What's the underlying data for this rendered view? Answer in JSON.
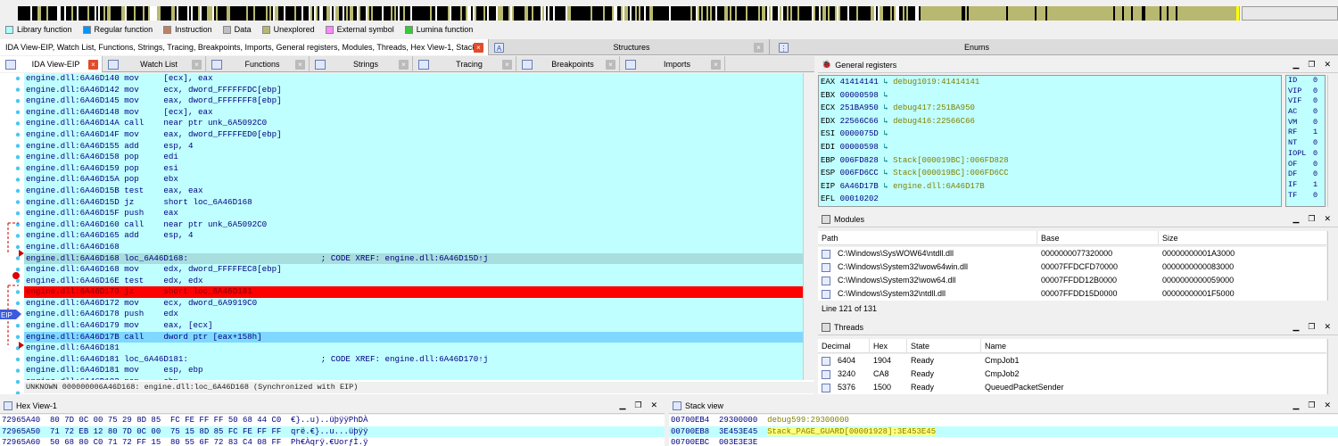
{
  "legend": [
    {
      "label": "Library function",
      "color": "#aaffff"
    },
    {
      "label": "Regular function",
      "color": "#0095ff"
    },
    {
      "label": "Instruction",
      "color": "#c08060"
    },
    {
      "label": "Data",
      "color": "#c0c0c0"
    },
    {
      "label": "Unexplored",
      "color": "#b8b870"
    },
    {
      "label": "External symbol",
      "color": "#ff88ff"
    },
    {
      "label": "Lumina function",
      "color": "#33cc33"
    }
  ],
  "top_tabs": {
    "main": "IDA View-EIP, Watch List, Functions, Strings, Tracing, Breakpoints, Imports, General registers, Modules, Threads, Hex View-1, Stack view",
    "structures": "Structures",
    "enums": "Enums",
    "close": "×"
  },
  "sub_tabs": [
    {
      "label": "IDA View-EIP",
      "icon": "ida-view-icon"
    },
    {
      "label": "Watch List",
      "icon": "watch-icon"
    },
    {
      "label": "Functions",
      "icon": "function-icon"
    },
    {
      "label": "Strings",
      "icon": "strings-icon"
    },
    {
      "label": "Tracing",
      "icon": "tracing-icon"
    },
    {
      "label": "Breakpoints",
      "icon": "breakpoints-icon"
    },
    {
      "label": "Imports",
      "icon": "imports-icon"
    }
  ],
  "code_lines": [
    {
      "t": "engine.dll:6A46D140 mov     [ecx], eax",
      "k": ""
    },
    {
      "t": "engine.dll:6A46D142 mov     ecx, dword_FFFFFFDC[ebp]",
      "k": ""
    },
    {
      "t": "engine.dll:6A46D145 mov     eax, dword_FFFFFFF8[ebp]",
      "k": ""
    },
    {
      "t": "engine.dll:6A46D148 mov     [ecx], eax",
      "k": ""
    },
    {
      "t": "engine.dll:6A46D14A call    near ptr unk_6A5092C0",
      "k": ""
    },
    {
      "t": "engine.dll:6A46D14F mov     eax, dword_FFFFFED0[ebp]",
      "k": ""
    },
    {
      "t": "engine.dll:6A46D155 add     esp, 4",
      "k": ""
    },
    {
      "t": "engine.dll:6A46D158 pop     edi",
      "k": ""
    },
    {
      "t": "engine.dll:6A46D159 pop     esi",
      "k": ""
    },
    {
      "t": "engine.dll:6A46D15A pop     ebx",
      "k": ""
    },
    {
      "t": "engine.dll:6A46D15B test    eax, eax",
      "k": ""
    },
    {
      "t": "engine.dll:6A46D15D jz      short loc_6A46D168",
      "k": ""
    },
    {
      "t": "engine.dll:6A46D15F push    eax",
      "k": ""
    },
    {
      "t": "engine.dll:6A46D160 call    near ptr unk_6A5092C0",
      "k": ""
    },
    {
      "t": "engine.dll:6A46D165 add     esp, 4",
      "k": ""
    },
    {
      "t": "engine.dll:6A46D168",
      "k": ""
    },
    {
      "t": "engine.dll:6A46D168 loc_6A46D168:                           ; CODE XREF: engine.dll:6A46D15D↑j",
      "k": "xref"
    },
    {
      "t": "engine.dll:6A46D168 mov     edx, dword_FFFFFEC8[ebp]",
      "k": ""
    },
    {
      "t": "engine.dll:6A46D16E test    edx, edx",
      "k": ""
    },
    {
      "t": "engine.dll:6A46D170 jz      short loc_6A46D181",
      "k": "bp"
    },
    {
      "t": "engine.dll:6A46D172 mov     ecx, dword_6A9919C0",
      "k": ""
    },
    {
      "t": "engine.dll:6A46D178 push    edx",
      "k": ""
    },
    {
      "t": "engine.dll:6A46D179 mov     eax, [ecx]",
      "k": ""
    },
    {
      "t": "engine.dll:6A46D17B call    dword ptr [eax+158h]",
      "k": "cur"
    },
    {
      "t": "engine.dll:6A46D181",
      "k": ""
    },
    {
      "t": "engine.dll:6A46D181 loc_6A46D181:                           ; CODE XREF: engine.dll:6A46D170↑j",
      "k": ""
    },
    {
      "t": "engine.dll:6A46D181 mov     esp, ebp",
      "k": ""
    },
    {
      "t": "engine.dll:6A46D183 pop     ebp",
      "k": ""
    },
    {
      "t": "engine.dll:6A46D184 retn",
      "k": ""
    }
  ],
  "eip_marker": "EIP",
  "status_line": "UNKNOWN 000000006A46D168: engine.dll:loc_6A46D168 (Synchronized with EIP)",
  "registers_pane": {
    "title": "General registers",
    "rows": [
      {
        "name": "EAX",
        "value": "41414141",
        "ref": "debug1019:41414141"
      },
      {
        "name": "EBX",
        "value": "00000598",
        "ref": ""
      },
      {
        "name": "ECX",
        "value": "251BA950",
        "ref": "debug417:251BA950"
      },
      {
        "name": "EDX",
        "value": "22566C66",
        "ref": "debug416:22566C66"
      },
      {
        "name": "ESI",
        "value": "0000075D",
        "ref": ""
      },
      {
        "name": "EDI",
        "value": "00000598",
        "ref": ""
      },
      {
        "name": "EBP",
        "value": "006FD828",
        "ref": "Stack[000019BC]:006FD828"
      },
      {
        "name": "ESP",
        "value": "006FD6CC",
        "ref": "Stack[000019BC]:006FD6CC"
      },
      {
        "name": "EIP",
        "value": "6A46D17B",
        "ref": "engine.dll:6A46D17B"
      },
      {
        "name": "EFL",
        "value": "00010202",
        "ref": ""
      }
    ],
    "flags": [
      {
        "k": "ID",
        "v": "0"
      },
      {
        "k": "VIP",
        "v": "0"
      },
      {
        "k": "VIF",
        "v": "0"
      },
      {
        "k": "AC",
        "v": "0"
      },
      {
        "k": "VM",
        "v": "0"
      },
      {
        "k": "RF",
        "v": "1"
      },
      {
        "k": "NT",
        "v": "0"
      },
      {
        "k": "IOPL",
        "v": "0"
      },
      {
        "k": "OF",
        "v": "0"
      },
      {
        "k": "DF",
        "v": "0"
      },
      {
        "k": "IF",
        "v": "1"
      },
      {
        "k": "TF",
        "v": "0"
      }
    ],
    "arrow": "↳"
  },
  "modules_pane": {
    "title": "Modules",
    "headers": [
      "Path",
      "Base",
      "Size"
    ],
    "rows": [
      {
        "path": "C:\\Windows\\SysWOW64\\ntdll.dll",
        "base": "0000000077320000",
        "size": "00000000001A3000"
      },
      {
        "path": "C:\\Windows\\System32\\wow64win.dll",
        "base": "00007FFDCFD70000",
        "size": "0000000000083000"
      },
      {
        "path": "C:\\Windows\\System32\\wow64.dll",
        "base": "00007FFDD12B0000",
        "size": "0000000000059000"
      },
      {
        "path": "C:\\Windows\\System32\\ntdll.dll",
        "base": "00007FFDD15D0000",
        "size": "00000000001F5000"
      }
    ],
    "footer": "Line 121 of 131"
  },
  "threads_pane": {
    "title": "Threads",
    "headers": [
      "Decimal",
      "Hex",
      "State",
      "Name"
    ],
    "rows": [
      {
        "dec": "6404",
        "hex": "1904",
        "state": "Ready",
        "name": "CmpJob1"
      },
      {
        "dec": "3240",
        "hex": "CA8",
        "state": "Ready",
        "name": "CmpJob2"
      },
      {
        "dec": "5376",
        "hex": "1500",
        "state": "Ready",
        "name": "QueuedPacketSender"
      }
    ]
  },
  "hex_pane": {
    "title": "Hex View-1",
    "rows": [
      {
        "t": "72965A40  80 7D 0C 00 75 29 8D 85  FC FE FF FF 50 68 44 C0  €}..u)..üþÿÿPhDÀ"
      },
      {
        "t": "72965A50  71 72 EB 12 80 7D 0C 00  75 15 8D 85 FC FE FF FF  qrë.€}..u...üþÿÿ"
      },
      {
        "t": "72965A60  50 68 80 C0 71 72 FF 15  80 55 6F 72 83 C4 08 FF  Ph€Àqrÿ.€Uorƒİ.ÿ"
      }
    ]
  },
  "stack_pane": {
    "title": "Stack view",
    "rows": [
      {
        "addr": "00700EB4",
        "val": "29300000",
        "ref": "debug599:29300000"
      },
      {
        "addr": "00700EB8",
        "val": "3E453E45",
        "ref": "Stack_PAGE_GUARD[00001928]:3E453E45"
      },
      {
        "addr": "00700EBC",
        "val": "003E3E3E",
        "ref": ""
      }
    ]
  },
  "window_controls": {
    "min": "▁",
    "restore": "❐",
    "close": "✕"
  }
}
